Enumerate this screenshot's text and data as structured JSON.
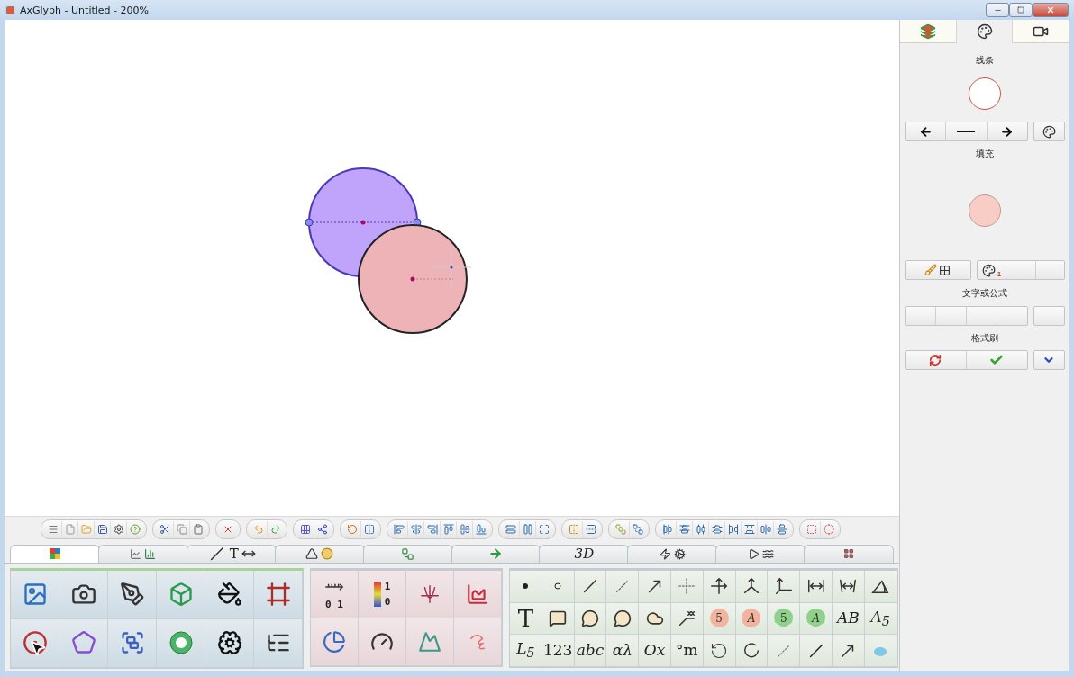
{
  "window": {
    "title": "AxGlyph - Untitled - 200%"
  },
  "canvas": {
    "shapes": [
      {
        "kind": "circle",
        "color": "#c0a4fb",
        "selected": true
      },
      {
        "kind": "circle",
        "color": "#eeb3b7",
        "selected": false
      }
    ]
  },
  "ribbon_tabs": [
    {
      "selected": true
    },
    {
      "selected": false
    },
    {
      "label": "T",
      "selected": false
    },
    {
      "selected": false
    },
    {
      "selected": false
    },
    {
      "selected": false
    },
    {
      "label": "3D",
      "selected": false
    },
    {
      "selected": false
    },
    {
      "selected": false
    },
    {
      "selected": false
    }
  ],
  "chart_palette": {
    "number_line_label": "0 1",
    "color_bar_labels": [
      "1",
      "0"
    ]
  },
  "symbol_palette": {
    "rows": [
      [
        {
          "kind": "icon"
        },
        {
          "kind": "icon"
        },
        {
          "kind": "icon"
        },
        {
          "kind": "icon"
        },
        {
          "kind": "icon"
        },
        {
          "kind": "icon"
        },
        {
          "kind": "icon"
        },
        {
          "kind": "icon"
        },
        {
          "kind": "icon"
        },
        {
          "kind": "icon"
        },
        {
          "kind": "icon"
        },
        {
          "kind": "icon"
        }
      ],
      [
        {
          "kind": "text",
          "text": "T",
          "italic": false
        },
        {
          "kind": "icon"
        },
        {
          "kind": "icon"
        },
        {
          "kind": "icon"
        },
        {
          "kind": "icon"
        },
        {
          "kind": "icon"
        },
        {
          "kind": "round-marker",
          "text": "5",
          "italic": false,
          "color": "#f2b49e"
        },
        {
          "kind": "round-marker",
          "text": "A",
          "italic": true,
          "color": "#f2b49e"
        },
        {
          "kind": "pin-marker",
          "text": "5",
          "italic": false,
          "color": "#8fd18a"
        },
        {
          "kind": "pin-marker",
          "text": "A",
          "italic": true,
          "color": "#8fd18a"
        },
        {
          "kind": "text",
          "text": "AB",
          "italic": true
        },
        {
          "kind": "text",
          "text": "A$_{5}$",
          "italic": true
        }
      ],
      [
        {
          "kind": "text",
          "text": "L$_{5}$",
          "italic": true
        },
        {
          "kind": "text",
          "text": "123",
          "italic": false
        },
        {
          "kind": "text",
          "text": "abc",
          "italic": true
        },
        {
          "kind": "text",
          "text": "αλ",
          "italic": true
        },
        {
          "kind": "text",
          "text": "Ox",
          "italic": true
        },
        {
          "kind": "text",
          "text": "°m",
          "italic": false
        },
        {
          "kind": "icon"
        },
        {
          "kind": "icon"
        },
        {
          "kind": "icon"
        },
        {
          "kind": "icon"
        },
        {
          "kind": "icon"
        },
        {
          "kind": "icon"
        }
      ]
    ]
  },
  "properties_panel": {
    "tabs": [
      {
        "selected": false
      },
      {
        "selected": true
      },
      {
        "selected": false
      }
    ],
    "stroke_label": "线条",
    "fill_label": "填充",
    "palette_badge": "1",
    "text_label": "文字或公式",
    "format_label": "格式刷"
  }
}
